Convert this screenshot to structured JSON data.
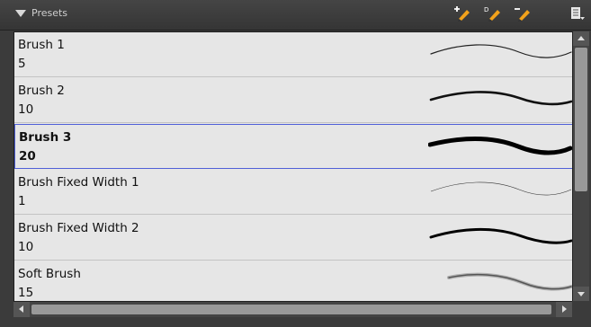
{
  "header": {
    "title": "Presets",
    "icons": [
      "add-preset-icon",
      "rename-preset-icon",
      "delete-preset-icon",
      "panel-menu-icon"
    ]
  },
  "presets": [
    {
      "name": "Brush 1",
      "size": "5",
      "selected": false
    },
    {
      "name": "Brush 2",
      "size": "10",
      "selected": false
    },
    {
      "name": "Brush 3",
      "size": "20",
      "selected": true
    },
    {
      "name": "Brush Fixed Width 1",
      "size": "1",
      "selected": false
    },
    {
      "name": "Brush Fixed Width 2",
      "size": "10",
      "selected": false
    },
    {
      "name": "Soft Brush",
      "size": "15",
      "selected": false
    }
  ],
  "colors": {
    "accent": "#5060d8",
    "icon_orange": "#f2a21b",
    "list_bg": "#e6e6e6"
  }
}
